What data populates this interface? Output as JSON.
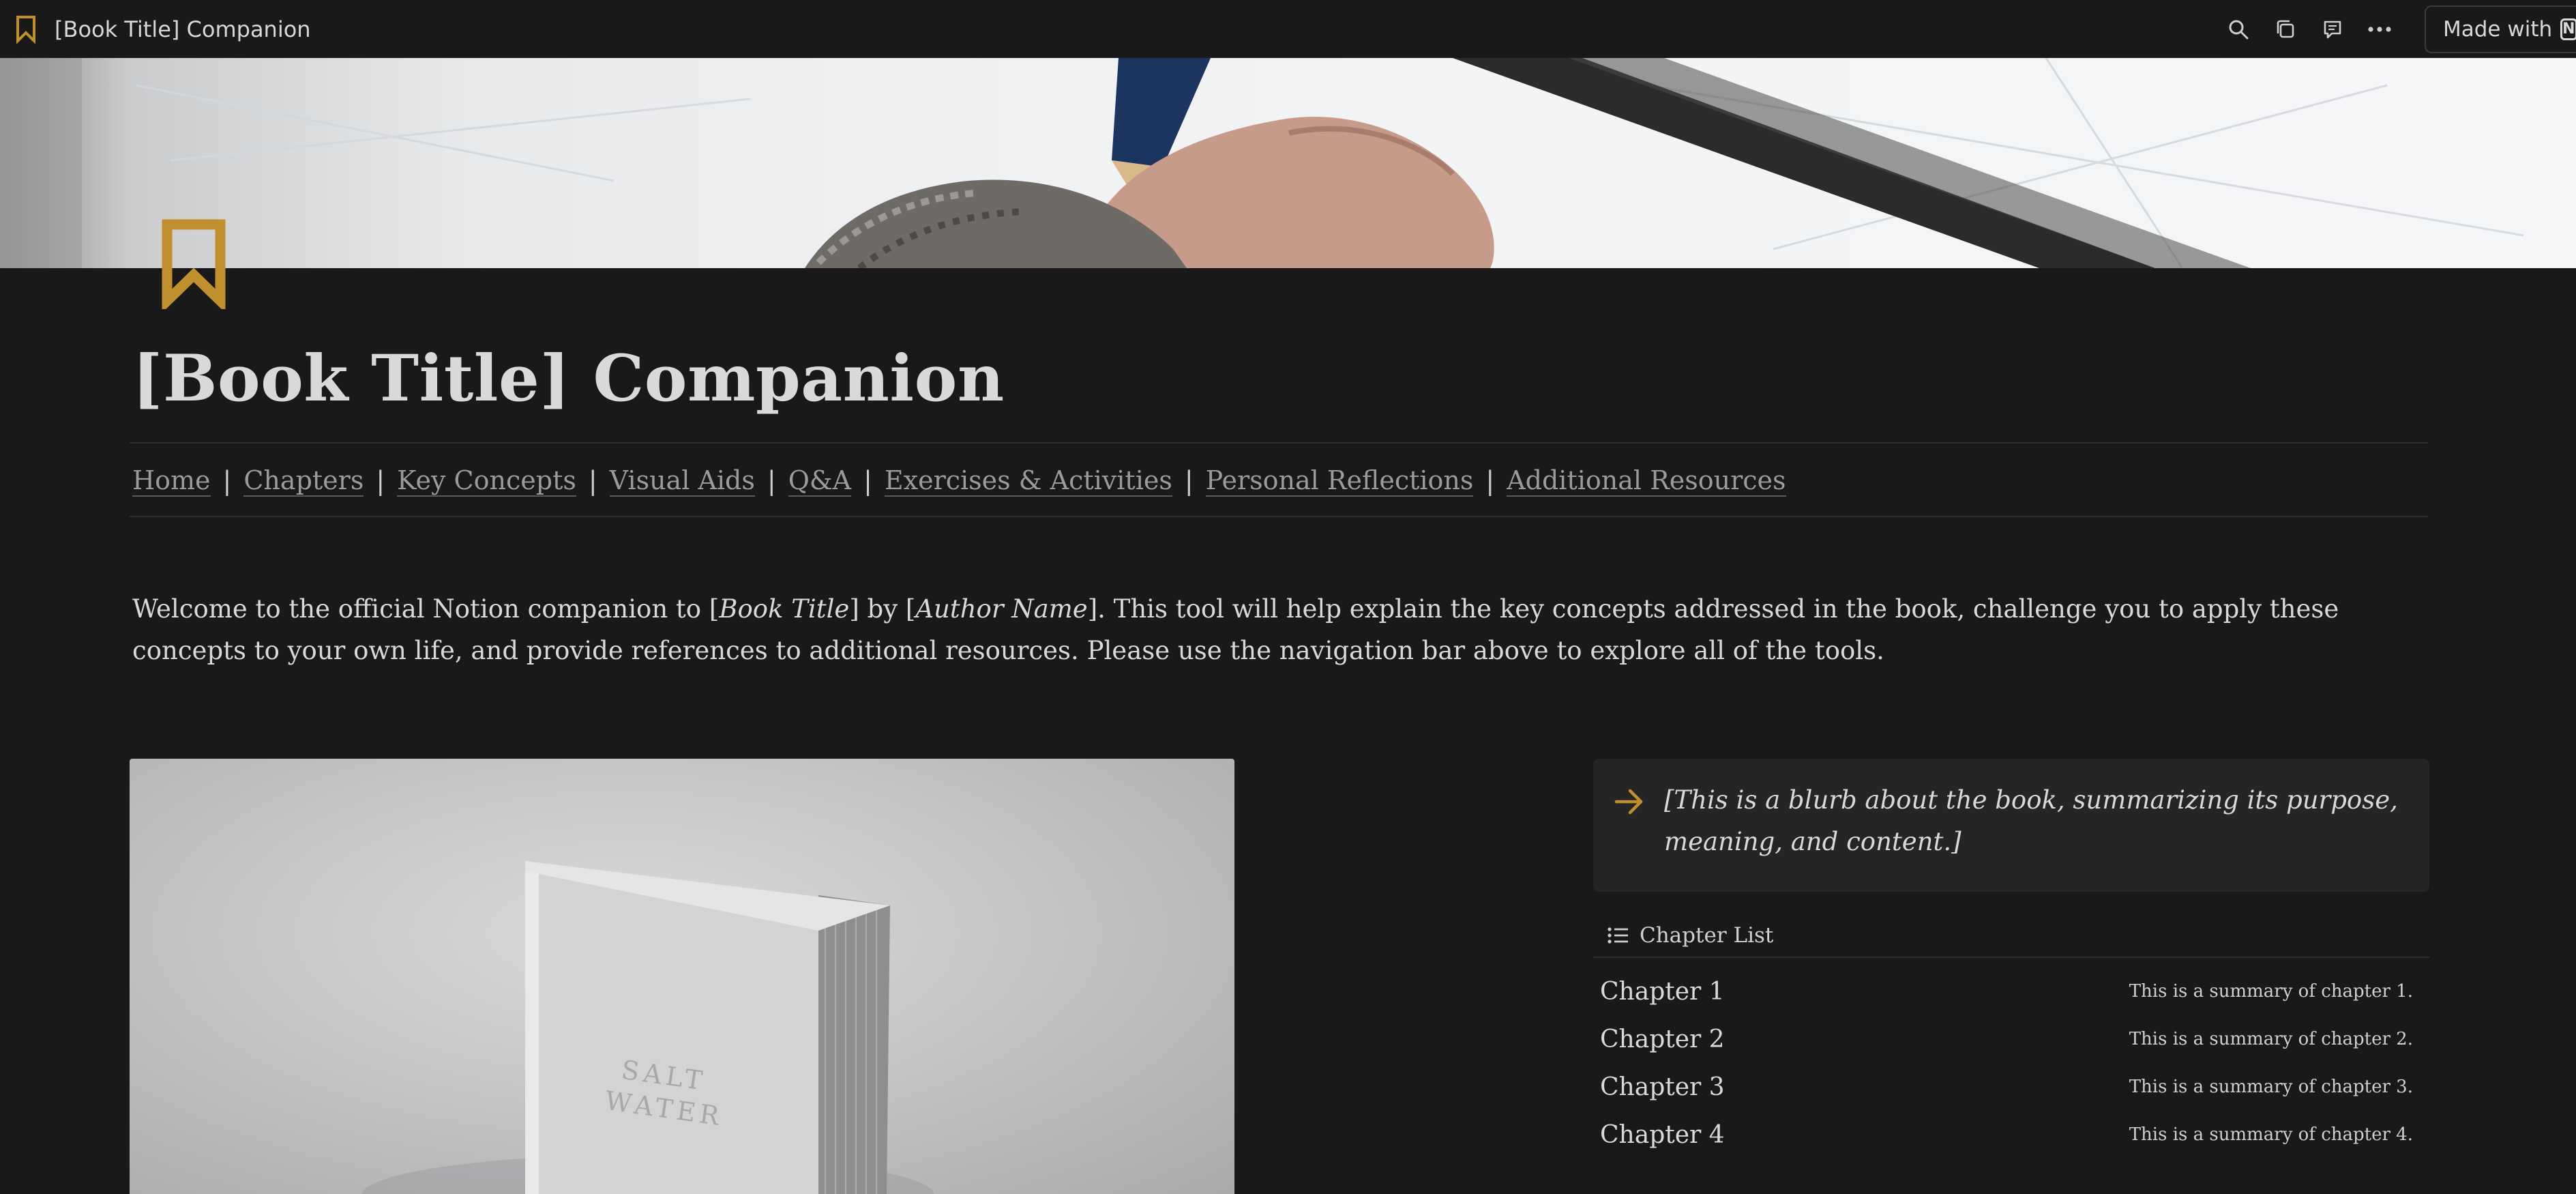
{
  "topbar": {
    "title": "[Book Title] Companion",
    "made_with_label": "Made with",
    "notion_glyph": "N",
    "icons": [
      "search-icon",
      "duplicate-icon",
      "comment-icon",
      "more-icon"
    ]
  },
  "page": {
    "title": "[Book Title] Companion",
    "accent_color": "#c0902f",
    "nav": [
      "Home",
      "Chapters",
      "Key Concepts",
      "Visual Aids",
      "Q&A",
      "Exercises & Activities",
      "Personal Reflections",
      "Additional Resources"
    ],
    "nav_separator": "|",
    "welcome": {
      "part1": "Welcome to the official Notion companion to [",
      "book_title": "Book Title",
      "part2": "] by [",
      "author_name": "Author Name",
      "part3": "].  This tool will help explain the key concepts addressed in the book, challenge you to apply these concepts to your own life, and provide references to additional resources.  Please use the navigation bar above to explore all of the tools."
    },
    "book_cover_text": [
      "SALT",
      "WATER"
    ],
    "callout": "[This is a blurb about the book, summarizing its purpose, meaning, and content.]",
    "chapter_list": {
      "title": "Chapter List",
      "rows": [
        {
          "name": "Chapter 1",
          "summary": "This is a summary of chapter 1."
        },
        {
          "name": "Chapter 2",
          "summary": "This is a summary of chapter 2."
        },
        {
          "name": "Chapter 3",
          "summary": "This is a summary of chapter 3."
        },
        {
          "name": "Chapter 4",
          "summary": "This is a summary of chapter 4."
        }
      ]
    }
  }
}
